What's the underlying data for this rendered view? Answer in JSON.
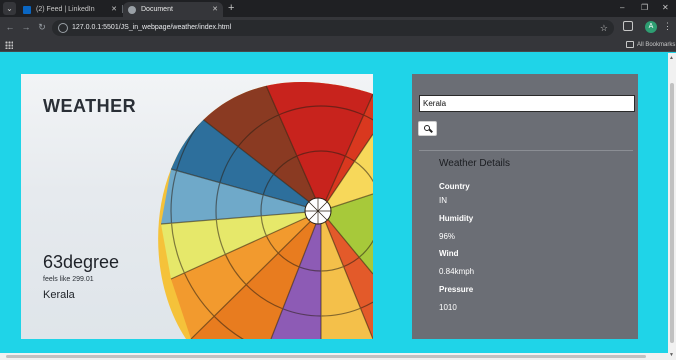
{
  "browser": {
    "tabs": [
      {
        "title": "(2) Feed | LinkedIn",
        "favicon": "linkedin-icon",
        "favicon_color": "#0a66c2",
        "active": false
      },
      {
        "title": "Document",
        "favicon": "globe-icon",
        "favicon_color": "#9aa0a6",
        "active": true
      }
    ],
    "tab_close_glyph": "✕",
    "new_tab_glyph": "+",
    "url": "127.0.0.1:5501/JS_in_webpage/weather/index.html",
    "profile_initial": "A",
    "bookmarks_label": "All Bookmarks"
  },
  "hero": {
    "title": "WEATHER",
    "temperature": "63degree",
    "feels_like_label": "feels like",
    "feels_like_value": "299.01",
    "city": "Kerala"
  },
  "search": {
    "value": "Kerala",
    "button_icon": "search-icon"
  },
  "details": {
    "heading": "Weather Details",
    "items": [
      {
        "label": "Country",
        "value": "IN"
      },
      {
        "label": "Humidity",
        "value": "96%"
      },
      {
        "label": "Wind",
        "value": "0.84kmph"
      },
      {
        "label": "Pressure",
        "value": "1010"
      }
    ]
  },
  "colors": {
    "page_background": "#1fd4e8",
    "panel_background": "#6b6e75",
    "browser_frame": "#1f2023",
    "browser_toolbar": "#35363a"
  }
}
